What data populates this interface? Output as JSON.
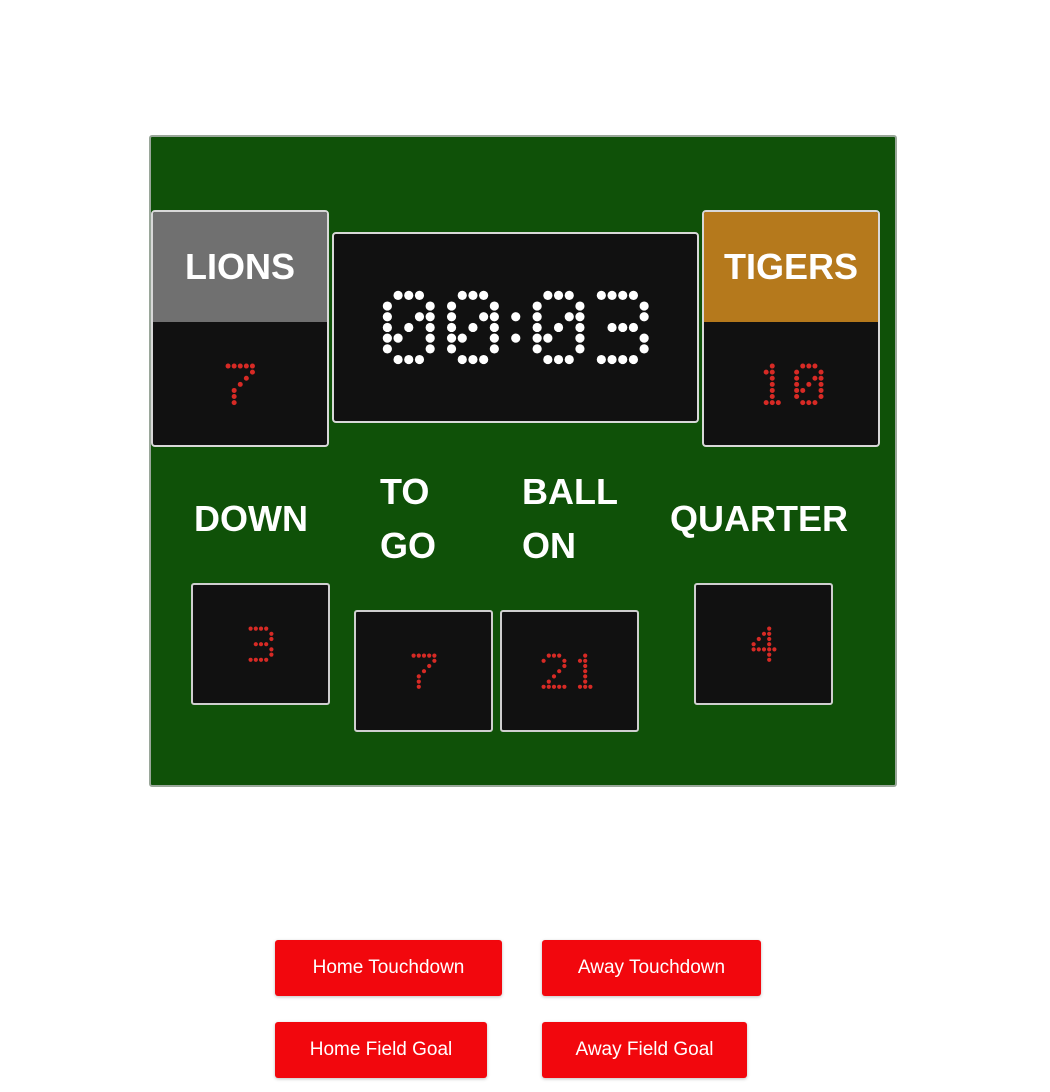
{
  "scoreboard": {
    "home": {
      "name": "LIONS",
      "score": "7"
    },
    "away": {
      "name": "TIGERS",
      "score": "10"
    },
    "clock": "00:03",
    "labels": {
      "down": "DOWN",
      "to_go": "TO\nGO",
      "ball_on": "BALL\nON",
      "quarter": "QUARTER"
    },
    "down": "3",
    "to_go": "7",
    "ball_on": "21",
    "quarter": "4"
  },
  "buttons": {
    "home_touchdown": "Home Touchdown",
    "away_touchdown": "Away Touchdown",
    "home_field_goal": "Home Field Goal",
    "away_field_goal": "Away Field Goal"
  },
  "colors": {
    "board": "#0f5108",
    "home_accent": "#707070",
    "away_accent": "#b5791c",
    "led_red": "#d72a25",
    "led_white": "#ffffff",
    "button": "#f2070d"
  }
}
